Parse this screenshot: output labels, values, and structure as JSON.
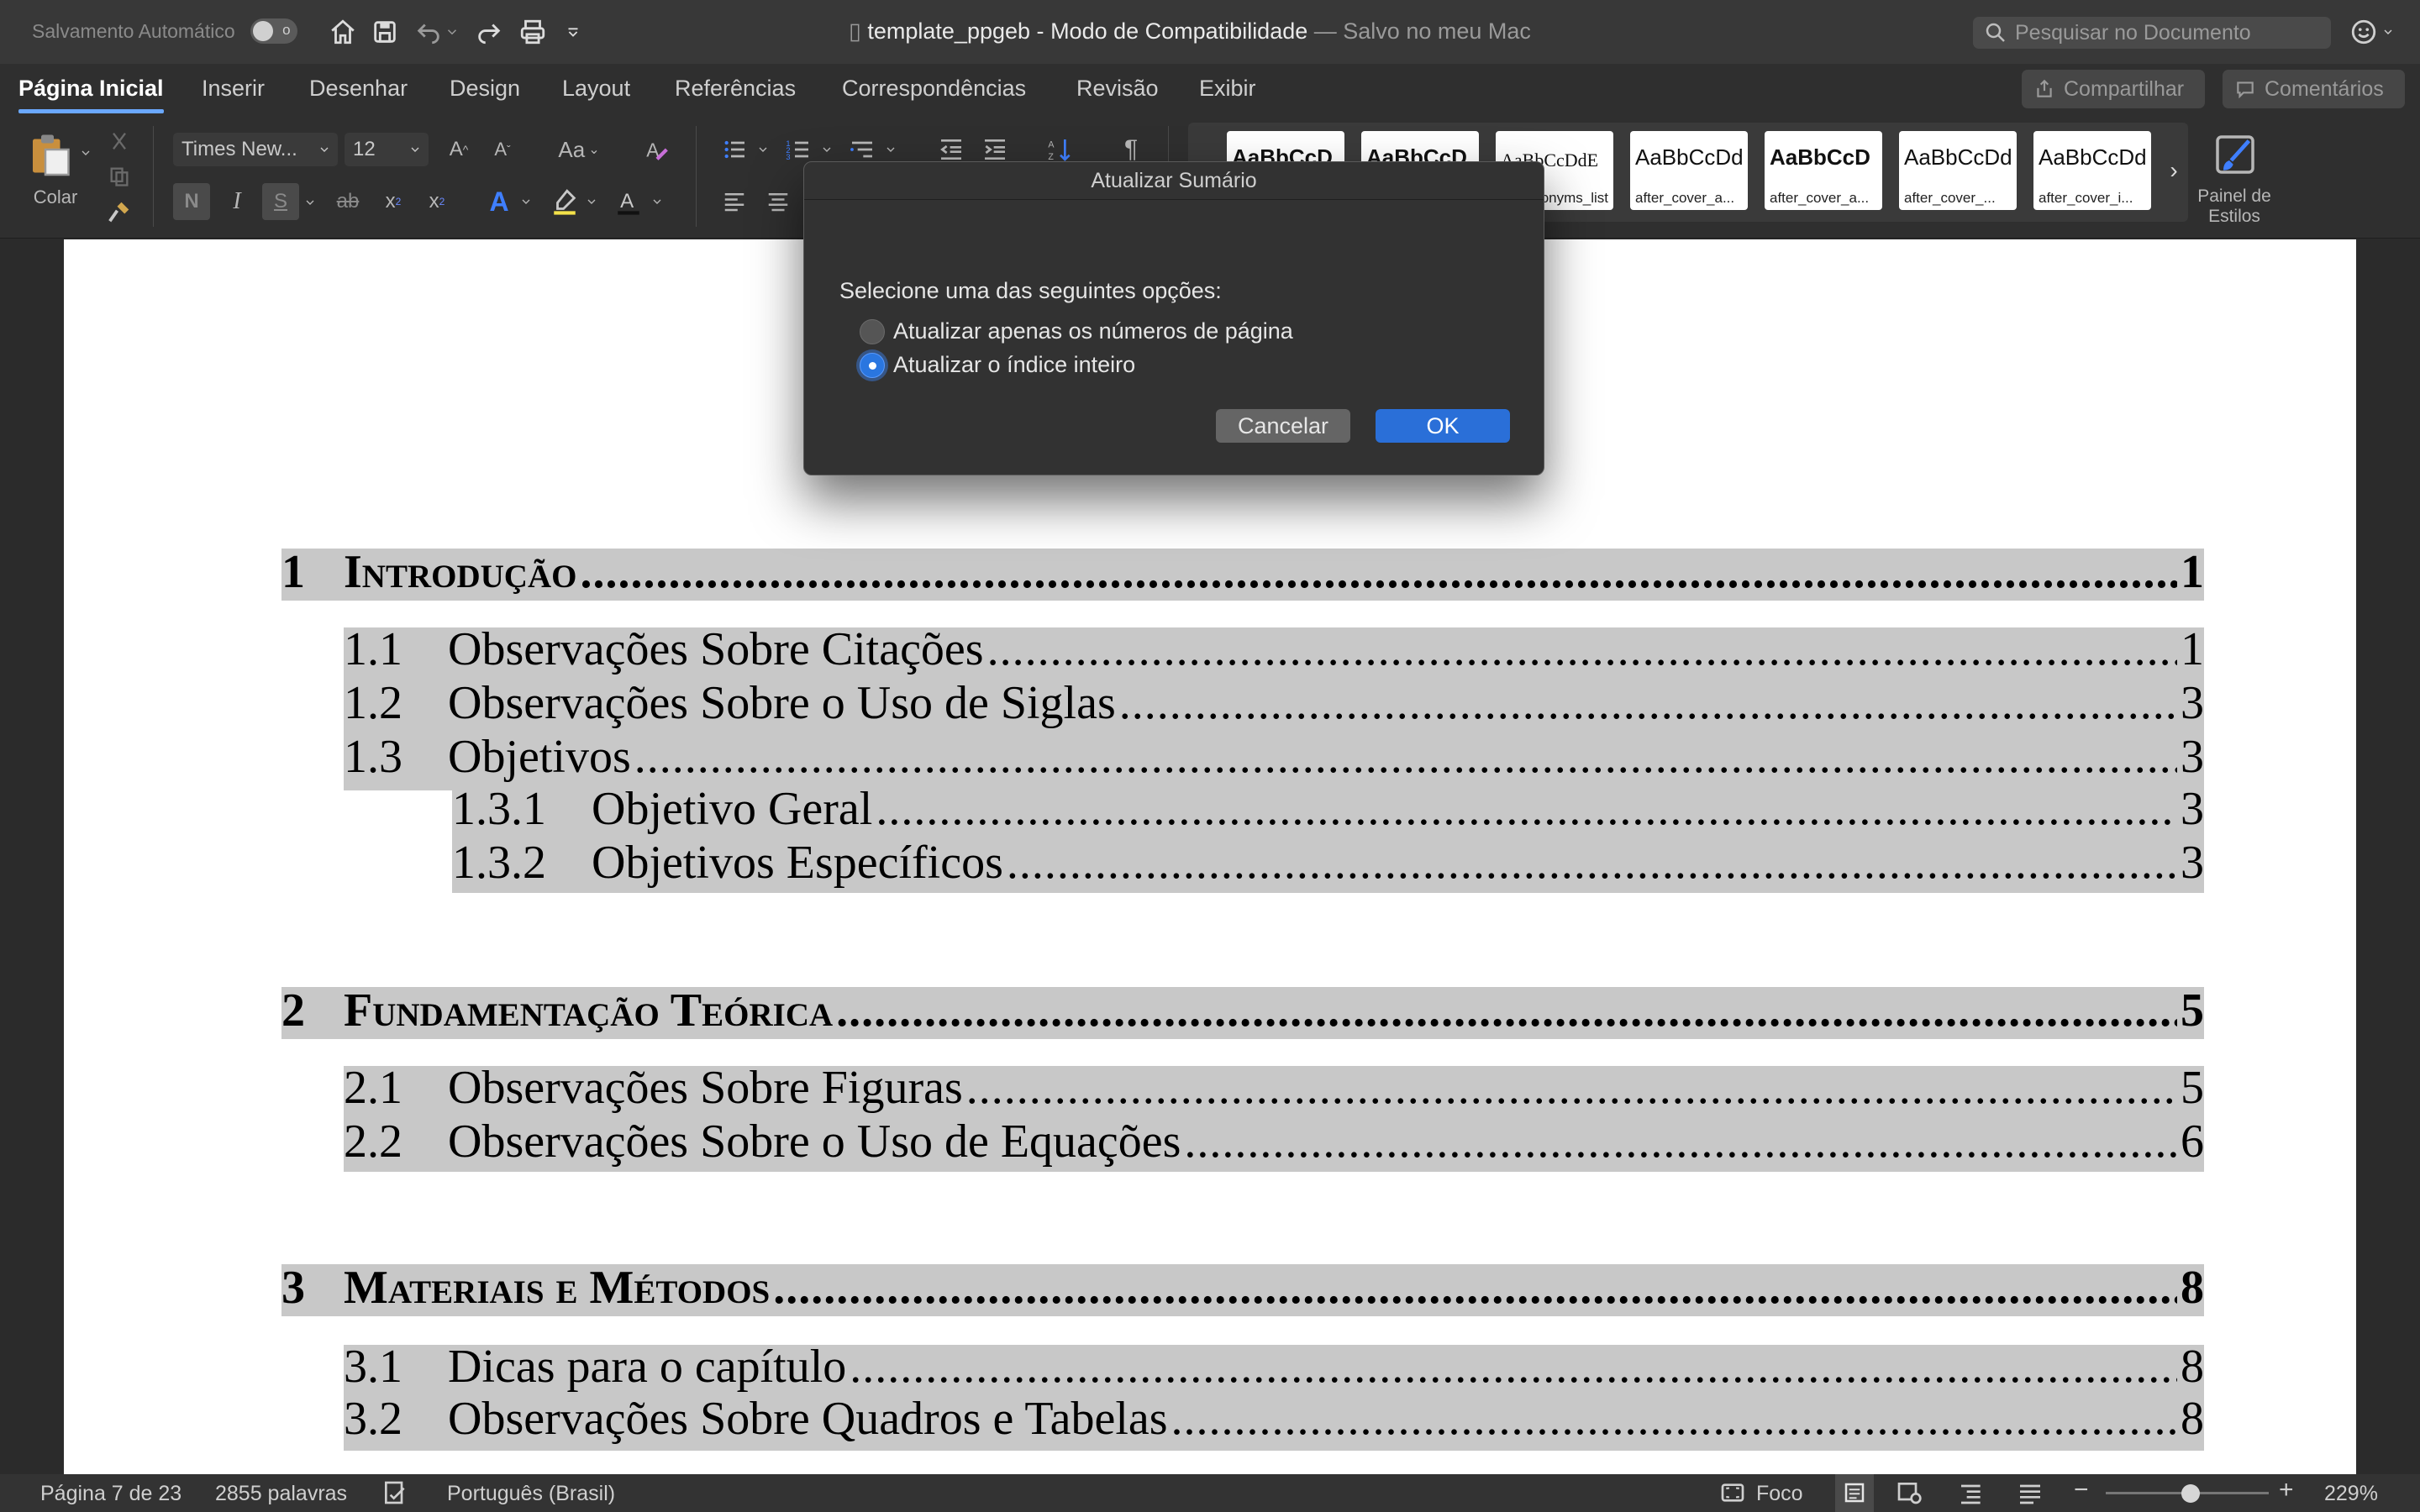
{
  "titlebar": {
    "autosave_label": "Salvamento Automático",
    "autosave_toggle": "o",
    "doc_name": "template_ppgeb",
    "separator": "-",
    "mode": "Modo de Compatibilidade",
    "saved_status": "— Salvo no meu Mac",
    "search_placeholder": "Pesquisar no Documento"
  },
  "tabs": [
    "Página Inicial",
    "Inserir",
    "Desenhar",
    "Design",
    "Layout",
    "Referências",
    "Correspondências",
    "Revisão",
    "Exibir"
  ],
  "share_label": "Compartilhar",
  "comments_label": "Comentários",
  "ribbon": {
    "paste_label": "Colar",
    "font_name": "Times New...",
    "font_size": "12",
    "bold": "N",
    "italic": "I",
    "underline": "S",
    "strike": "ab",
    "subscript": "x",
    "superscript": "x",
    "change_case": "Aa",
    "styles": [
      {
        "sample": "AaBbCcD",
        "caption": ""
      },
      {
        "sample": "AaBbCcD",
        "caption": ""
      },
      {
        "sample": "AaBbCcDdE",
        "caption": "acronyms_list"
      },
      {
        "sample": "AaBbCcDd",
        "caption": "after_cover_a..."
      },
      {
        "sample": "AaBbCcD",
        "caption": "after_cover_a..."
      },
      {
        "sample": "AaBbCcDd",
        "caption": "after_cover_..."
      },
      {
        "sample": "AaBbCcDd",
        "caption": "after_cover_i..."
      }
    ],
    "styles_pane": "Painel de Estilos"
  },
  "toc": [
    {
      "level": 1,
      "num": "1",
      "title": "Introdução",
      "page": "1"
    },
    {
      "level": 2,
      "num": "1.1",
      "title": "Observações Sobre Citações",
      "page": "1"
    },
    {
      "level": 2,
      "num": "1.2",
      "title": "Observações Sobre o Uso de Siglas",
      "page": "3"
    },
    {
      "level": 2,
      "num": "1.3",
      "title": "Objetivos",
      "page": "3"
    },
    {
      "level": 3,
      "num": "1.3.1",
      "title": "Objetivo Geral",
      "page": "3"
    },
    {
      "level": 3,
      "num": "1.3.2",
      "title": "Objetivos Específicos",
      "page": "3"
    },
    {
      "level": 1,
      "num": "2",
      "title": "Fundamentação Teórica",
      "page": "5"
    },
    {
      "level": 2,
      "num": "2.1",
      "title": "Observações Sobre Figuras",
      "page": "5"
    },
    {
      "level": 2,
      "num": "2.2",
      "title": "Observações Sobre o Uso de Equações",
      "page": "6"
    },
    {
      "level": 1,
      "num": "3",
      "title": "Materiais e Métodos",
      "page": "8"
    },
    {
      "level": 2,
      "num": "3.1",
      "title": "Dicas para o capítulo",
      "page": "8"
    },
    {
      "level": 2,
      "num": "3.2",
      "title": "Observações Sobre Quadros e Tabelas",
      "page": "8"
    }
  ],
  "dialog": {
    "title": "Atualizar Sumário",
    "prompt": "Selecione uma das seguintes opções:",
    "option_pages": "Atualizar apenas os números de página",
    "option_full": "Atualizar o índice inteiro",
    "selected": "option_full",
    "cancel": "Cancelar",
    "ok": "OK"
  },
  "statusbar": {
    "page_info": "Página 7 de 23",
    "words": "2855 palavras",
    "language": "Português (Brasil)",
    "focus": "Foco",
    "zoom": "229%",
    "zoom_level": 0.52
  },
  "colors": {
    "accent": "#2a6fd8",
    "toc_highlight": "#c8c8c8"
  }
}
